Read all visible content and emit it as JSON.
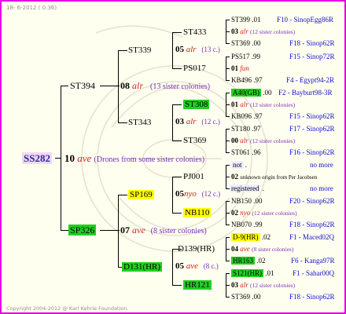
{
  "header_date": "18- 6-2012 ( 0:36)",
  "footer": "Copyright 2004-2012 @ Karl Kehrle Foundation.",
  "colors": {
    "border": "#e000e0",
    "queen": "#cc2222",
    "sister": "#7a2ab8",
    "right_text": "#1010c8",
    "green": "#20d020",
    "yellow": "#ffff00",
    "root_bg": "#f2d8f6"
  },
  "root": {
    "id": "SS282",
    "num": "10",
    "queen": "ave",
    "note": "(Drones from some sister colonies)"
  },
  "gen1": [
    {
      "id": "ST394",
      "num": "08",
      "queen": "alr",
      "note": "(13 sister colonies)"
    },
    {
      "id": "SP326",
      "num": "07",
      "queen": "ave",
      "note": "(8 sister colonies)"
    }
  ],
  "gen2": [
    {
      "id": "ST339",
      "num": "05",
      "queen": "alr",
      "note": "(13 c.)"
    },
    {
      "id": "ST343",
      "num": "03",
      "queen": "alr",
      "note": "(12 c.)"
    },
    {
      "id": "SP169",
      "num": "05",
      "queen": "nyo",
      "note": "(12 c.)"
    },
    {
      "id": "D131(HR)",
      "num": "05",
      "queen": "ave",
      "note": "(8 c.)"
    }
  ],
  "gen3": [
    {
      "id": "ST433"
    },
    {
      "id": "PS017",
      "num": "01",
      "queen": "fun"
    },
    {
      "id": "ST308"
    },
    {
      "id": "ST369"
    },
    {
      "id": "PJ001"
    },
    {
      "id": "NB110"
    },
    {
      "id": "D139(HR)"
    },
    {
      "id": "HR121"
    }
  ],
  "gen4": [
    {
      "id": "ST399",
      "val": ".01",
      "right": "F10 - SinopEgg86R"
    },
    {
      "id": "03",
      "queen": "alr",
      "note": "(12 sister colonies)"
    },
    {
      "id": "ST369",
      "val": ".00",
      "right": "F18 - Sinop62R"
    },
    {
      "id": "PS517",
      "val": ".99",
      "right": "F15 - Sinop72R"
    },
    {
      "id": "KB496",
      "val": ".97",
      "right": "F4 - Egypt94-2R"
    },
    {
      "id": "A40(GB)",
      "val": ".00",
      "right": "F2 - Bayburt98-3R"
    },
    {
      "id": "01",
      "queen": "alr",
      "note": "(12 sister colonies)"
    },
    {
      "id": "KB096",
      "val": ".97",
      "right": "F15 - Sinop62R"
    },
    {
      "id": "ST180",
      "val": ".97",
      "right": "F17 - Sinop62R"
    },
    {
      "id": "00",
      "queen": "alr",
      "note": "(12 sister colonies)"
    },
    {
      "id": "ST061",
      "val": ".96",
      "right": "F16 - Sinop62R"
    },
    {
      "id": "not",
      "val": ".",
      "right": "no more"
    },
    {
      "id": "02",
      "note": "unknown origin from Per Jacobsen"
    },
    {
      "id": "registered",
      "val": ".",
      "right": "no more"
    },
    {
      "id": "NB150",
      "val": ".00",
      "right": "F20 - Sinop62R"
    },
    {
      "id": "02",
      "queen": "nyo",
      "note": "(12 sister colonies)"
    },
    {
      "id": "NB070",
      "val": ".99",
      "right": "F18 - Sinop62R"
    },
    {
      "id": "D-9(HR)",
      "val": ".02",
      "right": "F1 - Maced02Q"
    },
    {
      "id": "04",
      "queen": "ave",
      "note": "(8 sister colonies)"
    },
    {
      "id": "HR163",
      "val": ".02",
      "right": "F6 - Kanga97R"
    },
    {
      "id": "S121(HR)",
      "val": ".01",
      "right": "F1 - Sahar00Q"
    },
    {
      "id": "03",
      "queen": "alr",
      "note": "(12 sister colonies)"
    },
    {
      "id": "ST369",
      "val": ".00",
      "right": "F18 - Sinop62R"
    }
  ]
}
